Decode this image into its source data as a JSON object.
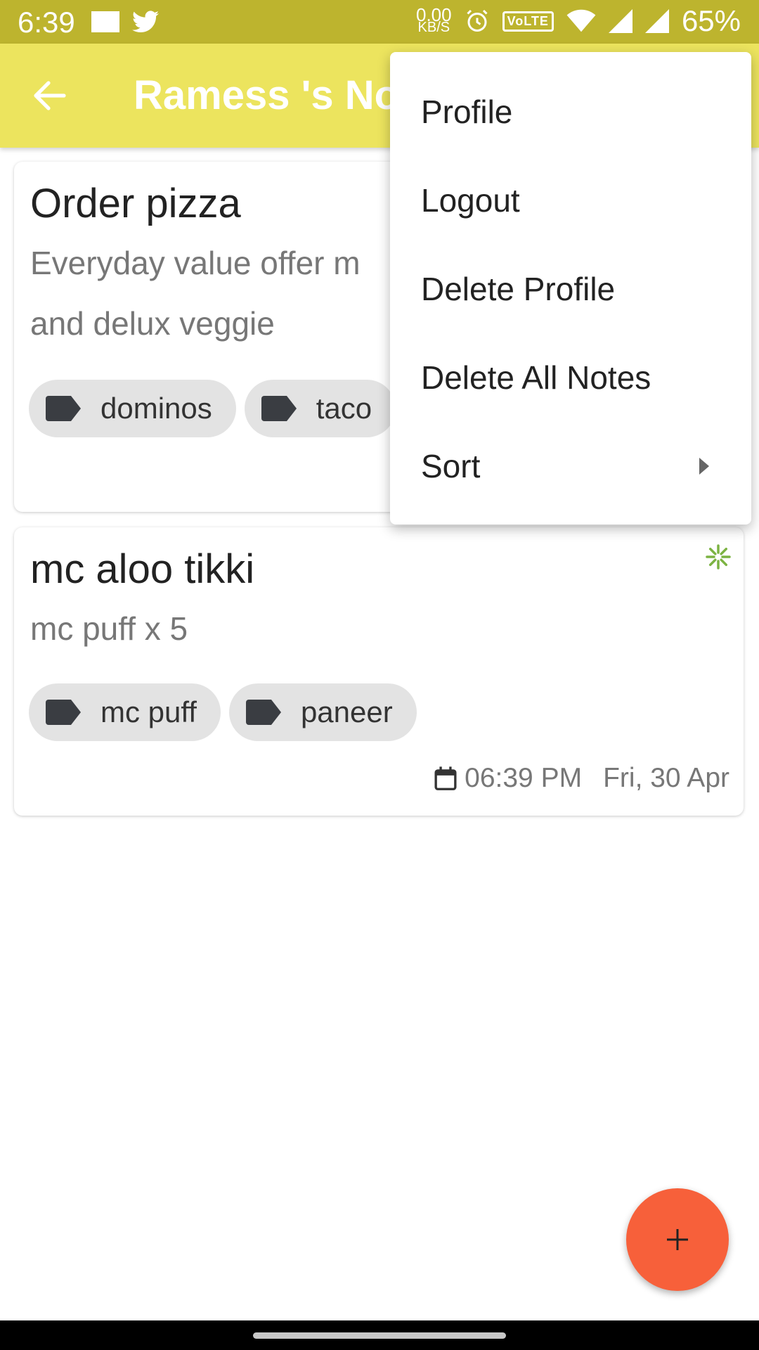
{
  "status_bar": {
    "time": "6:39",
    "net_speed_value": "0.00",
    "net_speed_unit": "KB/S",
    "volte": "VoLTE",
    "battery": "65%"
  },
  "app_bar": {
    "title": "Ramess 's Notes"
  },
  "notes": [
    {
      "title": "Order pizza",
      "body_line1": "Everyday value offer m",
      "body_line2": "and delux veggie",
      "tags": [
        "dominos",
        "taco"
      ]
    },
    {
      "title": "mc aloo tikki",
      "body_line1": "mc puff x 5",
      "tags": [
        "mc puff",
        "paneer"
      ],
      "time": "06:39 PM",
      "date": "Fri, 30 Apr"
    }
  ],
  "menu": {
    "items": [
      "Profile",
      "Logout",
      "Delete Profile",
      "Delete All Notes",
      "Sort"
    ]
  },
  "colors": {
    "status_bar": "#bdb42e",
    "app_bar": "#ece45e",
    "fab": "#f7603a",
    "pinwheel": "#7cb342"
  }
}
